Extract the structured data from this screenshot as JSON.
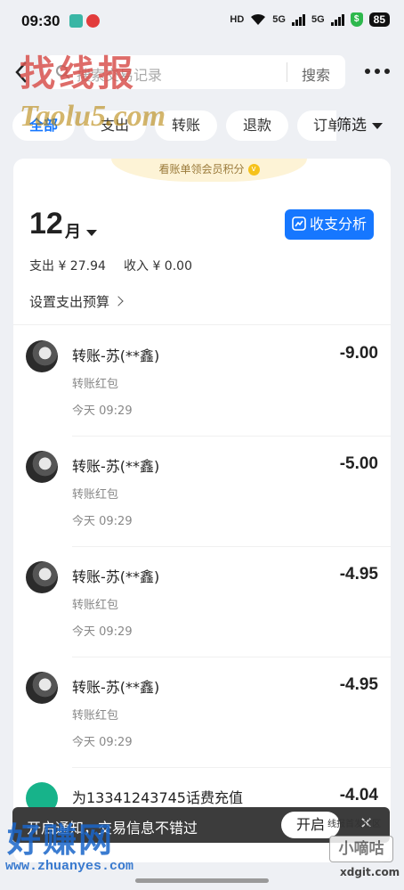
{
  "status_bar": {
    "time": "09:30",
    "signal_1": "5G",
    "signal_2": "5G",
    "battery": "85",
    "hd": "HD"
  },
  "header": {
    "search_placeholder": "搜索交易记录",
    "search_button": "搜索"
  },
  "filters": {
    "chips": [
      "全部",
      "支出",
      "转账",
      "退款",
      "订单"
    ],
    "filter_label": "筛选"
  },
  "banner": {
    "text": "看账单领会员积分"
  },
  "summary": {
    "month_number": "12",
    "month_suffix": "月",
    "analysis_button": "收支分析",
    "expense": "支出 ¥ 27.94",
    "income": "收入 ¥ 0.00",
    "budget": "设置支出预算"
  },
  "transactions": [
    {
      "title": "转账-苏(**鑫)",
      "subtitle": "转账红包",
      "date": "今天 09:29",
      "amount": "-9.00"
    },
    {
      "title": "转账-苏(**鑫)",
      "subtitle": "转账红包",
      "date": "今天 09:29",
      "amount": "-5.00"
    },
    {
      "title": "转账-苏(**鑫)",
      "subtitle": "转账红包",
      "date": "今天 09:29",
      "amount": "-4.95"
    },
    {
      "title": "转账-苏(**鑫)",
      "subtitle": "转账红包",
      "date": "今天 09:29",
      "amount": "-4.95"
    },
    {
      "title": "为13341243745话费充值",
      "subtitle": "",
      "date": "",
      "amount": "-4.04"
    }
  ],
  "toast": {
    "message": "开启通知，交易信息不错过",
    "button": "开启"
  },
  "watermarks": {
    "top": "找线报",
    "top_sub": "Taolu5.com",
    "bottom": "好赚网",
    "bottom_url": "www.zhuanyes.com",
    "right": "小嘀咕",
    "right_sub": "线报首发社区",
    "right_url": "xdgit.com"
  },
  "colors": {
    "accent": "#1677ff",
    "banner": "#fdf3d6"
  }
}
